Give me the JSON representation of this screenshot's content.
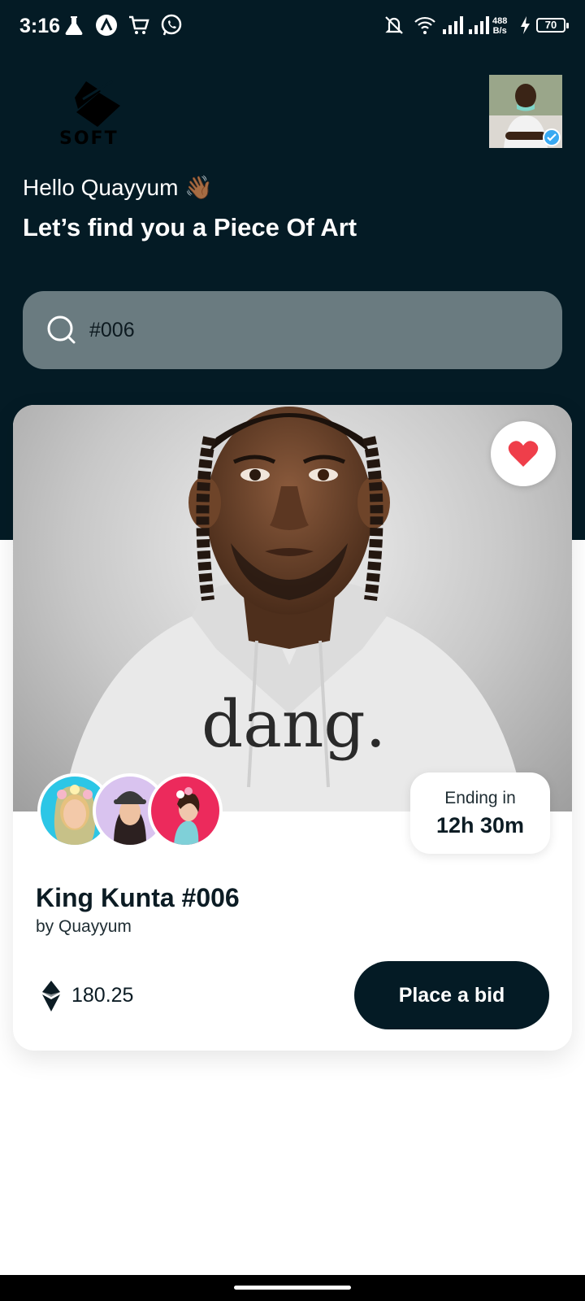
{
  "status_bar": {
    "time": "3:16",
    "net_speed_value": "488",
    "net_speed_unit": "B/s",
    "battery": "70",
    "icons": [
      "flask-icon",
      "app-logo-icon",
      "cart-icon",
      "whatsapp-icon",
      "bell-off-icon",
      "wifi-icon",
      "signal-icon",
      "signal-icon",
      "charging-icon",
      "battery-icon"
    ]
  },
  "header": {
    "logo_text": "SOFT",
    "greeting": "Hello Quayyum 👋🏾",
    "headline": "Let’s find you a Piece Of Art"
  },
  "search": {
    "value": "#006",
    "icon": "search-icon"
  },
  "card": {
    "image_caption": "dang.",
    "favorite_icon": "heart-icon",
    "favorite_color": "#ef3e4a",
    "ending_label": "Ending in",
    "ending_value": "12h 30m",
    "title": "King Kunta #006",
    "author": "by Quayyum",
    "price": "180.25",
    "price_icon": "ethereum-icon",
    "bid_button": "Place a bid",
    "bidders": [
      "bidder-1",
      "bidder-2",
      "bidder-3"
    ]
  },
  "colors": {
    "primary_dark": "#041b25",
    "search_bg": "#6a7b80",
    "accent_verified": "#39a9f2"
  }
}
